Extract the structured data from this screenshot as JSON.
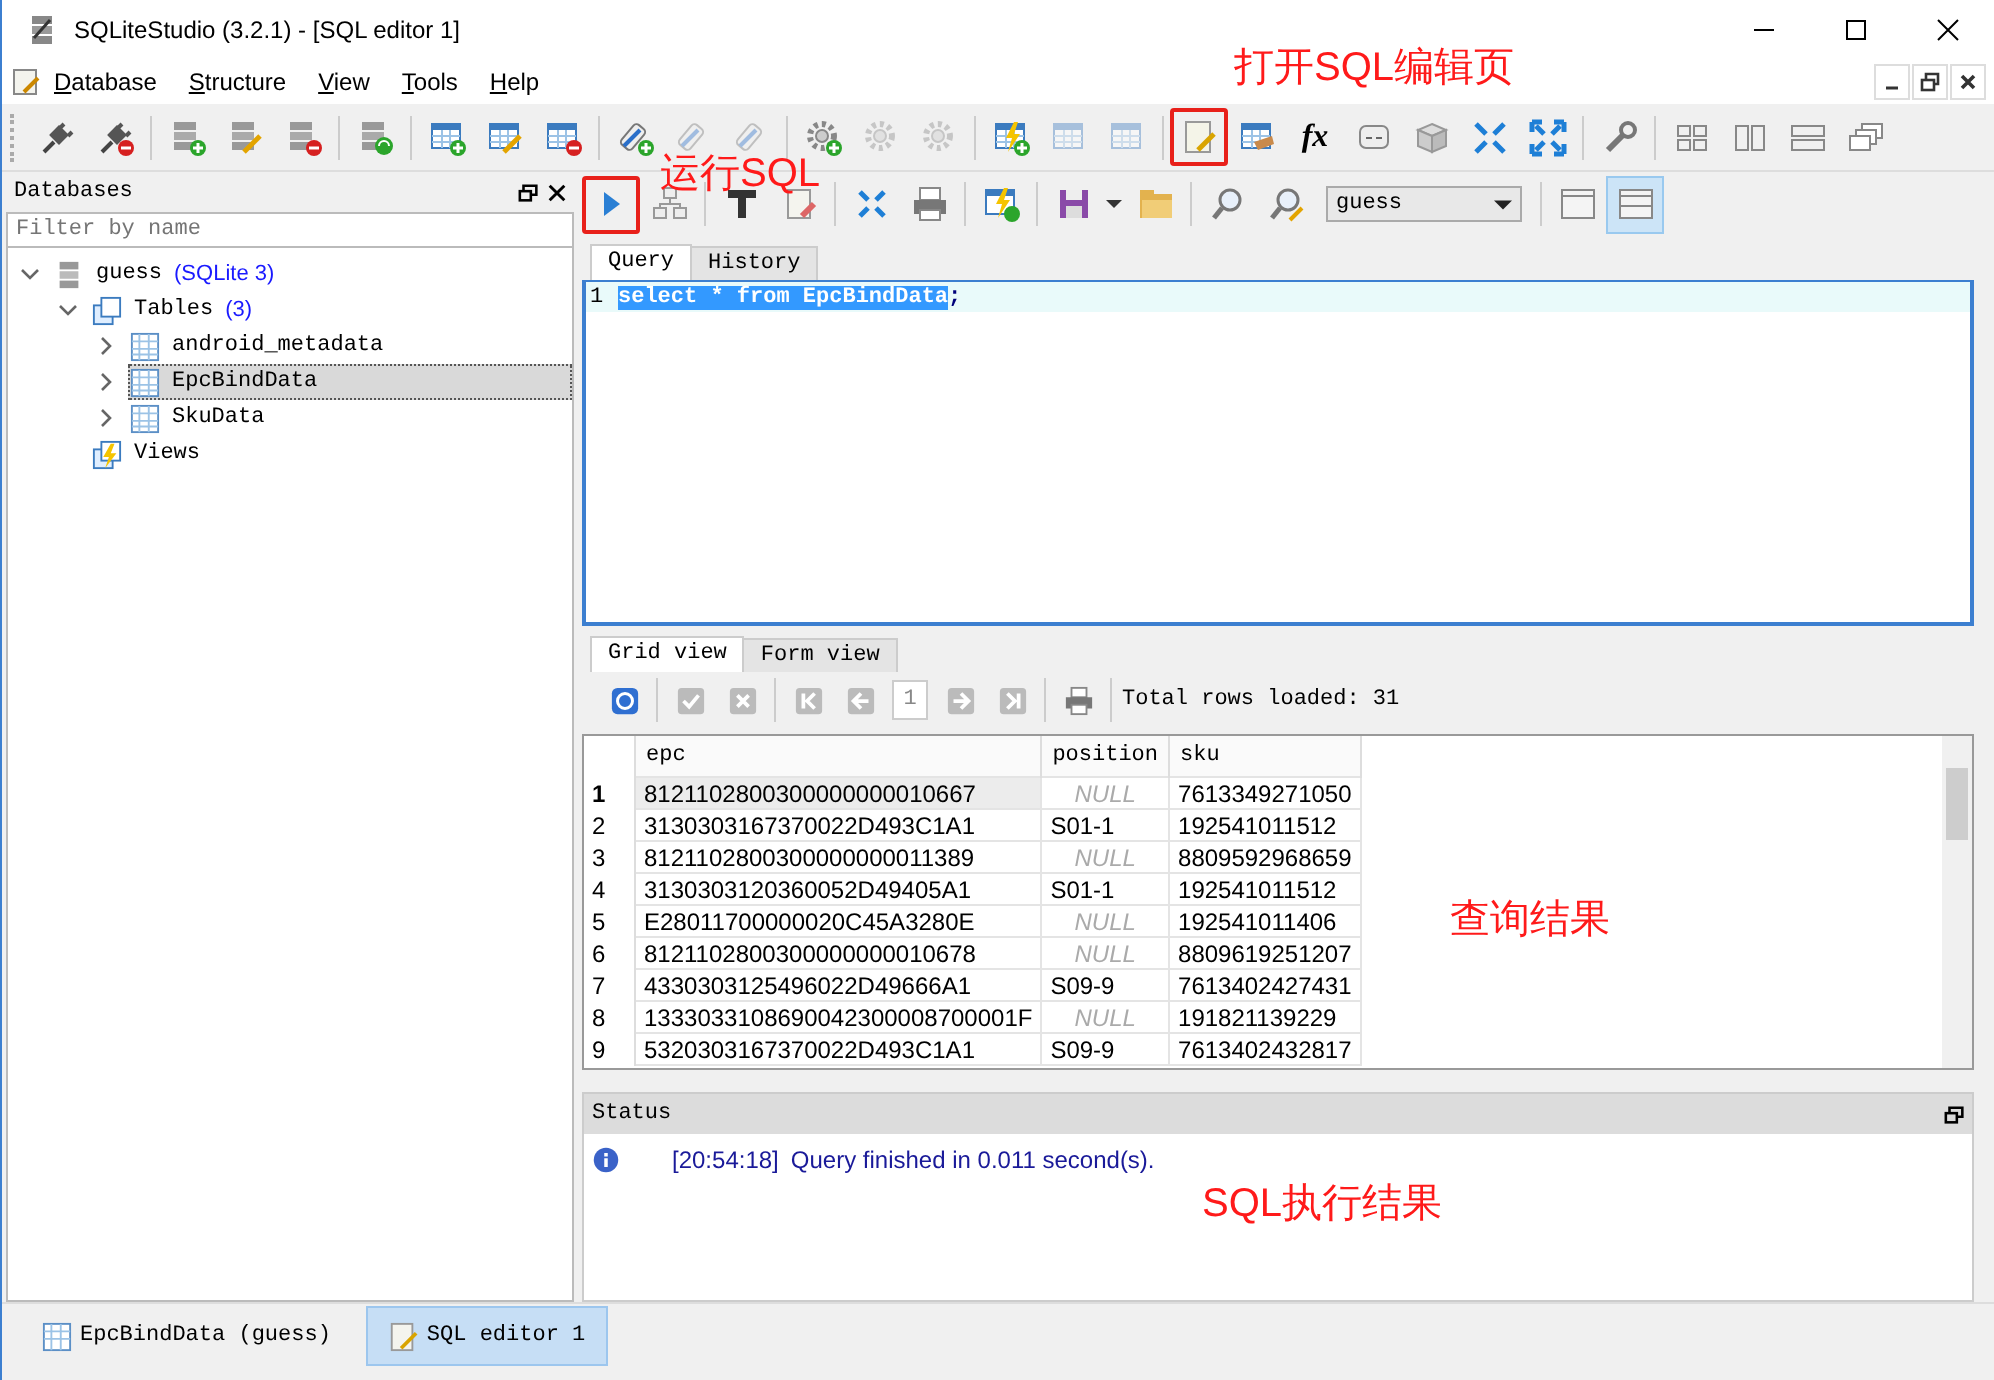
{
  "window": {
    "title": "SQLiteStudio (3.2.1) - [SQL editor 1]"
  },
  "menu": [
    "Database",
    "Structure",
    "View",
    "Tools",
    "Help"
  ],
  "main_toolbar": {
    "function_label": "fx"
  },
  "databases_panel": {
    "title": "Databases",
    "filter": {
      "placeholder": "Filter by name"
    },
    "tree": [
      {
        "kind": "database",
        "label": "guess",
        "count": "(SQLite 3)",
        "expanded": true,
        "selected": false,
        "children": [
          {
            "kind": "folder",
            "label": "Tables",
            "count": "(3)",
            "expanded": true,
            "selected": false,
            "children": [
              {
                "kind": "table",
                "label": "android_metadata",
                "expanded": false,
                "selected": false
              },
              {
                "kind": "table",
                "label": "EpcBindData",
                "expanded": false,
                "selected": true
              },
              {
                "kind": "table",
                "label": "SkuData",
                "expanded": false,
                "selected": false
              }
            ]
          },
          {
            "kind": "views",
            "label": "Views",
            "selected": false
          }
        ]
      }
    ]
  },
  "editor_toolbar": {
    "database": "guess",
    "layout_toggles": [
      {
        "selected": false
      },
      {
        "selected": true
      }
    ]
  },
  "editor_tabs": [
    {
      "label": "Query",
      "selected": true
    },
    {
      "label": "History",
      "selected": false
    }
  ],
  "editor": {
    "lines": [
      {
        "number": "1",
        "selected_text": "select * from EpcBindData",
        "rest": ";"
      }
    ]
  },
  "result_tabs": [
    {
      "label": "Grid view",
      "selected": true
    },
    {
      "label": "Form view",
      "selected": false
    }
  ],
  "grid_toolbar": {
    "page": "1",
    "total": "Total rows loaded: 31"
  },
  "table": {
    "columns": [
      "epc",
      "position",
      "sku"
    ],
    "rows": [
      {
        "number": "1",
        "selected": true,
        "epc": "8121102800300000000010667",
        "position": "NULL",
        "position_null": true,
        "sku": "7613349271050"
      },
      {
        "number": "2",
        "selected": false,
        "epc": "3130303167370022D493C1A1",
        "position": "S01-1",
        "position_null": false,
        "sku": "192541011512"
      },
      {
        "number": "3",
        "selected": false,
        "epc": "8121102800300000000011389",
        "position": "NULL",
        "position_null": true,
        "sku": "8809592968659"
      },
      {
        "number": "4",
        "selected": false,
        "epc": "3130303120360052D49405A1",
        "position": "S01-1",
        "position_null": false,
        "sku": "192541011512"
      },
      {
        "number": "5",
        "selected": false,
        "epc": "E28011700000020C45A3280E",
        "position": "NULL",
        "position_null": true,
        "sku": "192541011406"
      },
      {
        "number": "6",
        "selected": false,
        "epc": "8121102800300000000010678",
        "position": "NULL",
        "position_null": true,
        "sku": "8809619251207"
      },
      {
        "number": "7",
        "selected": false,
        "epc": "4330303125496022D49666A1",
        "position": "S09-9",
        "position_null": false,
        "sku": "7613402427431"
      },
      {
        "number": "8",
        "selected": false,
        "epc": "1333033108690042300008700001F",
        "position": "NULL",
        "position_null": true,
        "sku": "191821139229"
      },
      {
        "number": "9",
        "selected": false,
        "epc": "5320303167370022D493C1A1",
        "position": "S09-9",
        "position_null": false,
        "sku": "7613402432817"
      }
    ]
  },
  "status_panel": {
    "title": "Status",
    "messages": [
      {
        "time": "[20:54:18]",
        "text": "Query finished in 0.011 second(s)."
      }
    ]
  },
  "window_tabs": [
    {
      "label": "EpcBindData (guess)",
      "kind": "table",
      "selected": false
    },
    {
      "label": "SQL editor 1",
      "kind": "editor",
      "selected": true
    }
  ],
  "annotations": [
    {
      "text": "打开SQL编辑页"
    },
    {
      "text": "运行SQL"
    },
    {
      "text": "查询结果"
    },
    {
      "text": "SQL执行结果"
    }
  ]
}
